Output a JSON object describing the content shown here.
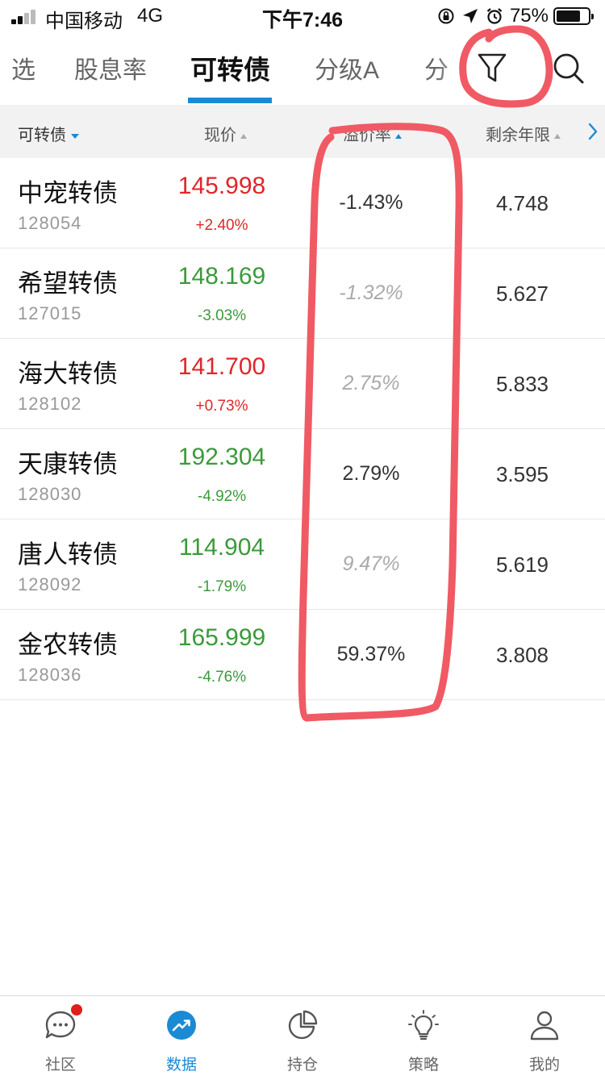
{
  "status_bar": {
    "carrier": "中国移动",
    "network": "4G",
    "time": "下午7:46",
    "battery": "75%",
    "battery_level": 0.75
  },
  "tabs": {
    "items": [
      "选",
      "股息率",
      "可转债",
      "分级A",
      "分"
    ],
    "active_index": 2
  },
  "table": {
    "headers": {
      "name": "可转债",
      "price": "现价",
      "premium": "溢价率",
      "years": "剩余年限"
    },
    "rows": [
      {
        "name": "中宠转债",
        "code": "128054",
        "price": "145.998",
        "change": "+2.40%",
        "direction": "up",
        "premium": "-1.43%",
        "premium_dim": false,
        "years": "4.748"
      },
      {
        "name": "希望转债",
        "code": "127015",
        "price": "148.169",
        "change": "-3.03%",
        "direction": "down",
        "premium": "-1.32%",
        "premium_dim": true,
        "years": "5.627"
      },
      {
        "name": "海大转债",
        "code": "128102",
        "price": "141.700",
        "change": "+0.73%",
        "direction": "up",
        "premium": "2.75%",
        "premium_dim": true,
        "years": "5.833"
      },
      {
        "name": "天康转债",
        "code": "128030",
        "price": "192.304",
        "change": "-4.92%",
        "direction": "down",
        "premium": "2.79%",
        "premium_dim": false,
        "years": "3.595"
      },
      {
        "name": "唐人转债",
        "code": "128092",
        "price": "114.904",
        "change": "-1.79%",
        "direction": "down",
        "premium": "9.47%",
        "premium_dim": true,
        "years": "5.619"
      },
      {
        "name": "金农转债",
        "code": "128036",
        "price": "165.999",
        "change": "-4.76%",
        "direction": "down",
        "premium": "59.37%",
        "premium_dim": false,
        "years": "3.808"
      }
    ]
  },
  "bottom_nav": {
    "items": [
      {
        "label": "社区",
        "icon": "chat-bubble-icon",
        "badge": true
      },
      {
        "label": "数据",
        "icon": "trend-chart-icon",
        "active": true
      },
      {
        "label": "持仓",
        "icon": "pie-chart-icon"
      },
      {
        "label": "策略",
        "icon": "lightbulb-icon"
      },
      {
        "label": "我的",
        "icon": "person-icon"
      }
    ]
  },
  "colors": {
    "accent": "#1a8ad4",
    "up": "#e0262b",
    "down": "#3b9a3b",
    "annotation": "#f05a64"
  }
}
